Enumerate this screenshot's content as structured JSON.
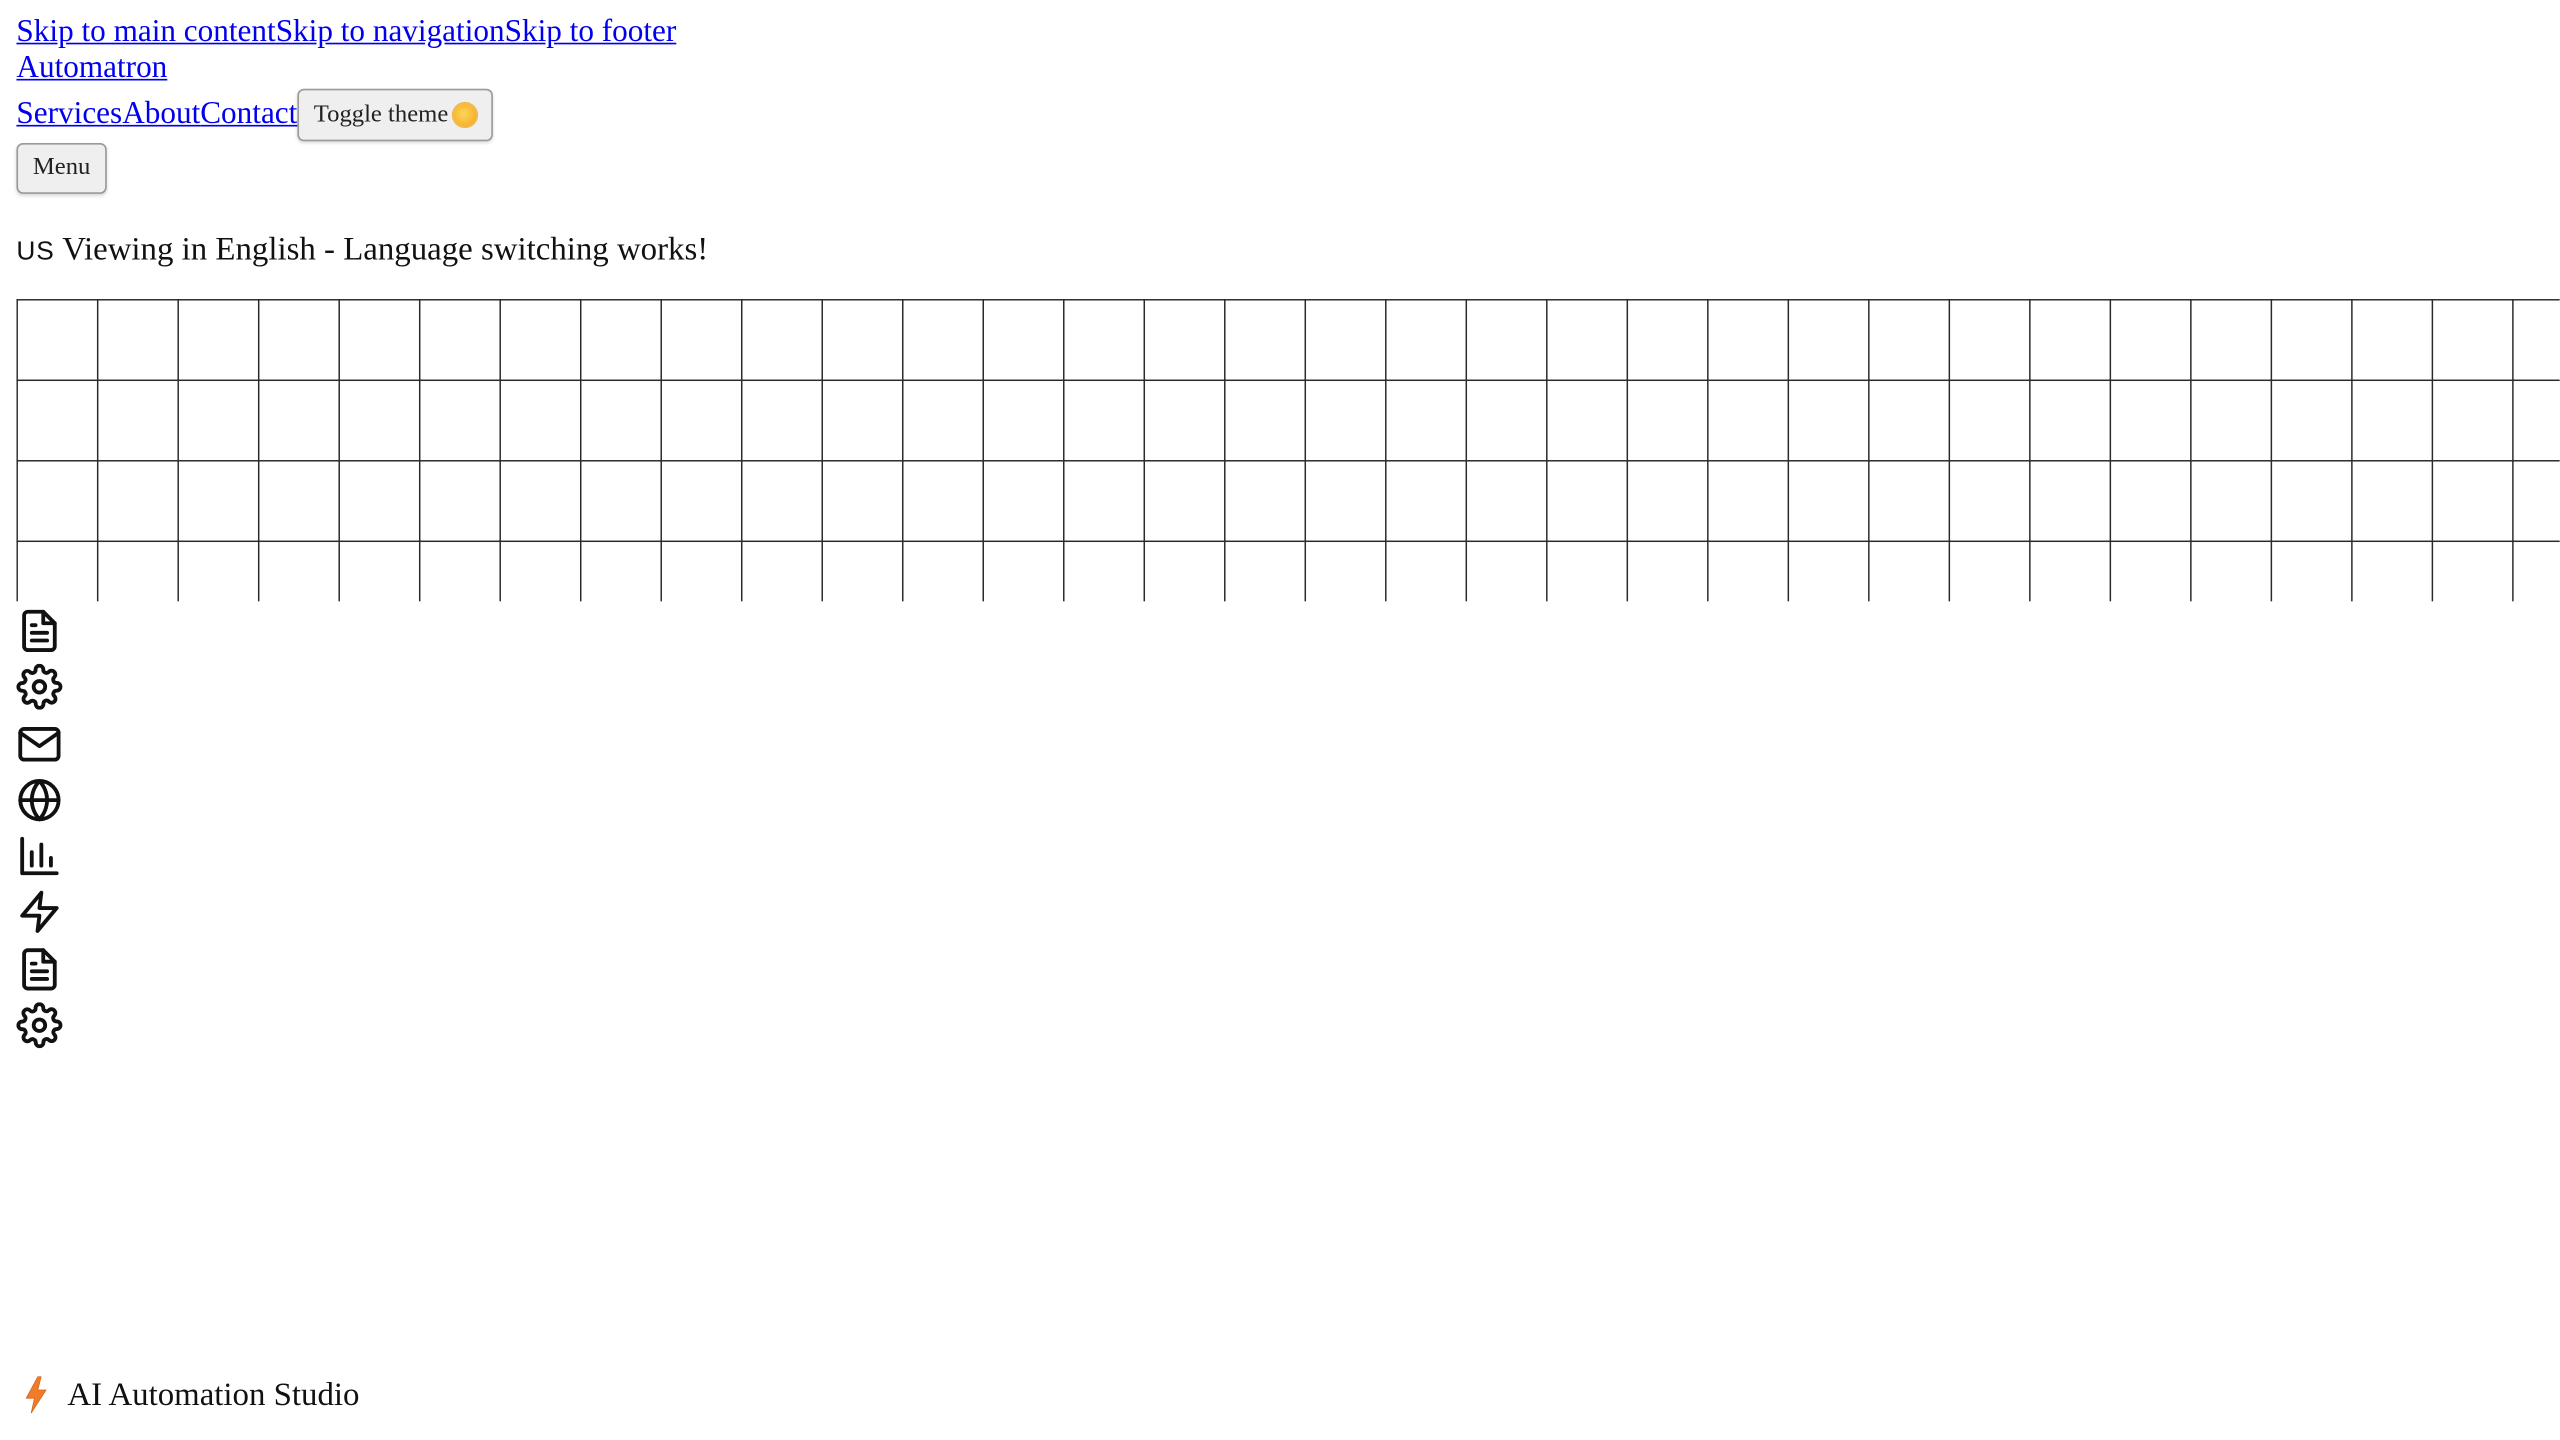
{
  "skip_links": [
    {
      "label": "Skip to main content"
    },
    {
      "label": "Skip to navigation"
    },
    {
      "label": "Skip to footer"
    }
  ],
  "brand": {
    "name": "Automatron"
  },
  "nav": {
    "items": [
      {
        "label": "Services"
      },
      {
        "label": "About"
      },
      {
        "label": "Contact"
      }
    ],
    "theme_toggle_label": "Toggle theme",
    "theme_icon": "sun-icon"
  },
  "menu_button": {
    "label": "Menu"
  },
  "language_notice": {
    "flag": "US",
    "text": "Viewing in English - Language switching works!"
  },
  "icons": [
    "file-text-icon",
    "gear-icon",
    "mail-icon",
    "globe-icon",
    "bar-chart-icon",
    "lightning-icon",
    "file-text-icon",
    "gear-icon"
  ],
  "footer": {
    "tagline": "AI Automation Studio",
    "icon": "lightning-icon",
    "accent": "#f07c2a"
  },
  "colors": {
    "link": "#0000ee",
    "grid_line": "#2a2a2a",
    "background": "#ffffff"
  }
}
